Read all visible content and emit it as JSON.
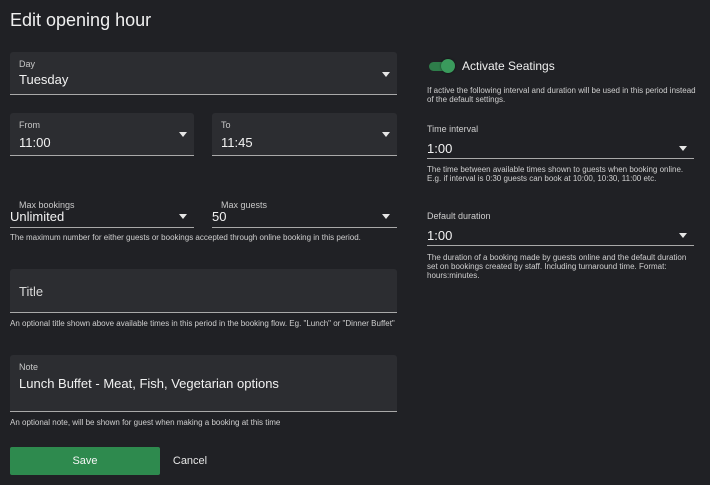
{
  "dialog": {
    "title": "Edit opening hour"
  },
  "day": {
    "label": "Day",
    "value": "Tuesday"
  },
  "from": {
    "label": "From",
    "value": "11:00"
  },
  "to": {
    "label": "To",
    "value": "11:45"
  },
  "max_bookings": {
    "label": "Max bookings",
    "value": "Unlimited",
    "helper": "The maximum number for either guests or bookings accepted through online booking in this period."
  },
  "max_guests": {
    "label": "Max guests",
    "value": "50"
  },
  "title_field": {
    "placeholder": "Title",
    "helper": "An optional title shown above available times in this period in the booking flow. Eg. \"Lunch\" or \"Dinner Buffet\""
  },
  "note": {
    "label": "Note",
    "value": "Lunch Buffet - Meat, Fish, Vegetarian options",
    "helper": "An optional note, will be shown for guest when making a booking at this time"
  },
  "seatings": {
    "label": "Activate Seatings",
    "enabled": true,
    "helper": "If active the following interval and duration will be used in this period instead of the default settings."
  },
  "time_interval": {
    "label": "Time interval",
    "value": "1:00",
    "helper": "The time between available times shown to guests when booking online. E.g. if interval is 0:30 guests can book at 10:00, 10:30, 11:00 etc."
  },
  "default_duration": {
    "label": "Default duration",
    "value": "1:00",
    "helper": "The duration of a booking made by guests online and the default duration set on bookings created by staff. Including turnaround time. Format: hours:minutes."
  },
  "actions": {
    "save": "Save",
    "cancel": "Cancel"
  },
  "colors": {
    "background": "#202125",
    "field": "#2c2d31",
    "accent": "#2e8a4e"
  }
}
